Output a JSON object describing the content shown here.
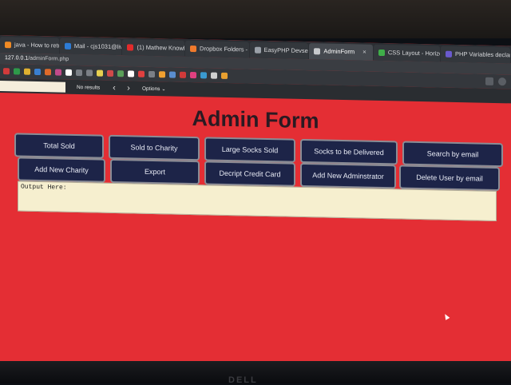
{
  "browser": {
    "tabs": [
      {
        "label": "java - How to return a s",
        "color": "#f08a24"
      },
      {
        "label": "Mail - cjs1031@live.esu",
        "color": "#2d7cd6"
      },
      {
        "label": "(1) Mathew Knowles dis",
        "color": "#e22b2b"
      },
      {
        "label": "Dropbox Folders - Data",
        "color": "#f07a2c"
      },
      {
        "label": "EasyPHP Devserver",
        "color": "#9aa0a8"
      },
      {
        "label": "AdminForm",
        "color": "#c7c9cc"
      },
      {
        "label": "CSS Layout - Horizontal",
        "color": "#3fae49"
      },
      {
        "label": "PHP Variables declaratio",
        "color": "#6a5acd"
      }
    ],
    "active_tab_close": "×",
    "address": {
      "host": "127.0.0.1",
      "path": "/adminForm.php"
    },
    "bookmark_colors": [
      "#d23b3b",
      "#2e9a4a",
      "#e0b030",
      "#3a7fd0",
      "#e06a2a",
      "#c24a8a",
      "#ffffff",
      "#7b7f86",
      "#7b7f86",
      "#e8d050",
      "#d04a4a",
      "#5aa05a",
      "#ffffff",
      "#e04040",
      "#7b7f86",
      "#f0a030",
      "#5a8ed0",
      "#d03a3a",
      "#e04080",
      "#3a9ad0",
      "#d0d0d0",
      "#e8a030"
    ],
    "find": {
      "status": "No results",
      "prev": "‹",
      "next": "›",
      "options": "Options ⌄"
    }
  },
  "form": {
    "title": "Admin Form",
    "buttons_row1": [
      {
        "label": "Total Sold",
        "name": "total-sold-button"
      },
      {
        "label": "Sold to Charity",
        "name": "sold-to-charity-button"
      },
      {
        "label": "Large Socks Sold",
        "name": "large-socks-sold-button"
      },
      {
        "label": "Socks to be Delivered",
        "name": "socks-to-be-delivered-button"
      },
      {
        "label": "Search by email",
        "name": "search-by-email-button"
      }
    ],
    "buttons_row2": [
      {
        "label": "Add New Charity",
        "name": "add-new-charity-button"
      },
      {
        "label": "Export",
        "name": "export-button"
      },
      {
        "label": "Decript Credit Card",
        "name": "decript-credit-card-button"
      },
      {
        "label": "Add New Adminstrator",
        "name": "add-new-adminstrator-button"
      },
      {
        "label": "Delete User by email",
        "name": "delete-user-by-email-button"
      }
    ],
    "output_placeholder": "Output Here:"
  },
  "monitor": {
    "brand": "DELL"
  }
}
